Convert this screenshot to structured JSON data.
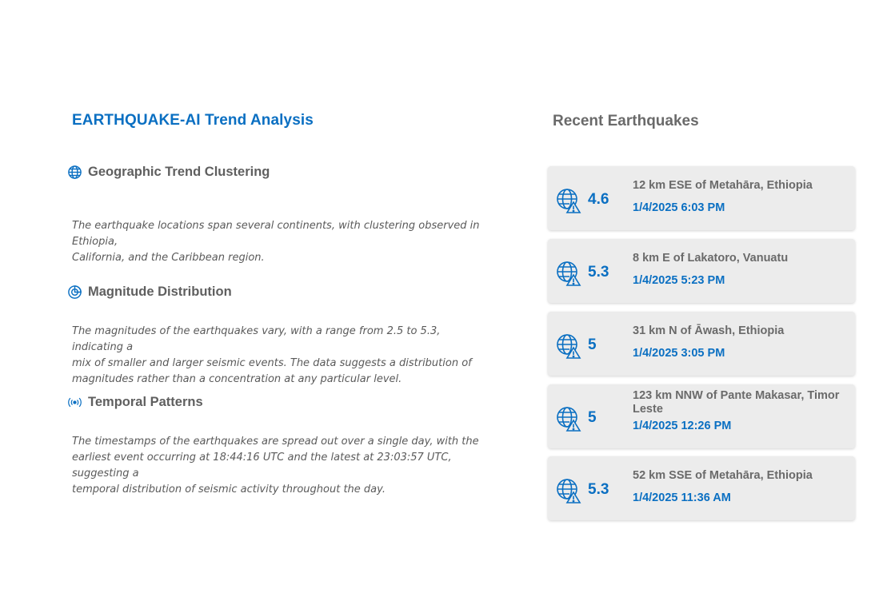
{
  "analysis": {
    "title": "EARTHQUAKE-AI Trend Analysis",
    "sections": [
      {
        "icon": "globe-icon",
        "title": "Geographic Trend Clustering",
        "lines": [
          "The earthquake locations span several continents, with clustering observed in Ethiopia,",
          "California, and the Caribbean region."
        ]
      },
      {
        "icon": "magnitude-icon",
        "title": "Magnitude Distribution",
        "lines": [
          "The magnitudes of the earthquakes vary, with a range from 2.5 to 5.3, indicating a",
          "mix of smaller and larger seismic events. The data suggests a distribution of",
          "magnitudes rather than a concentration at any particular level."
        ]
      },
      {
        "icon": "broadcast-icon",
        "title": "Temporal Patterns",
        "lines": [
          "The timestamps of the earthquakes are spread out over a single day, with the",
          "earliest event occurring at 18:44:16 UTC and the latest at 23:03:57 UTC, suggesting a",
          "temporal distribution of seismic activity throughout the day."
        ]
      }
    ]
  },
  "recent": {
    "title": "Recent Earthquakes",
    "items": [
      {
        "magnitude": "4.6",
        "location": "12 km ESE of Metahāra, Ethiopia",
        "date": "1/4/2025 6:03 PM"
      },
      {
        "magnitude": "5.3",
        "location": "8 km E of Lakatoro, Vanuatu",
        "date": "1/4/2025 5:23 PM"
      },
      {
        "magnitude": "5",
        "location": "31 km N of Āwash, Ethiopia",
        "date": "1/4/2025 3:05 PM"
      },
      {
        "magnitude": "5",
        "location": "123 km NNW of Pante Makasar, Timor Leste",
        "date": "1/4/2025 12:26 PM"
      },
      {
        "magnitude": "5.3",
        "location": "52 km SSE of Metahāra, Ethiopia",
        "date": "1/4/2025 11:36 AM"
      }
    ]
  },
  "colors": {
    "accent": "#0a6fc2",
    "heading": "#5f5f5f",
    "card": "#ececec"
  }
}
